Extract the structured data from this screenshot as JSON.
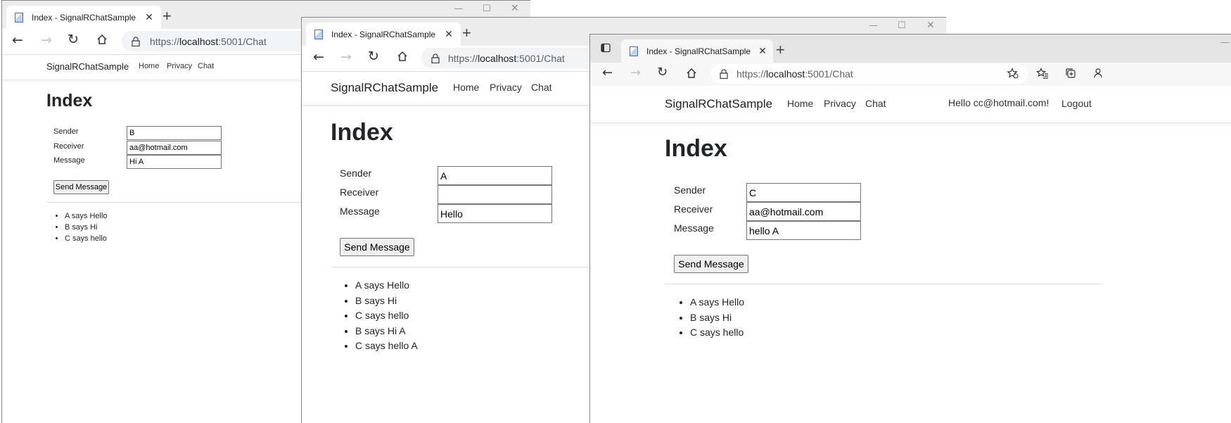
{
  "windows": [
    {
      "tab_title": "Index - SignalRChatSample",
      "url_prefix": "https://",
      "url_host": "localhost",
      "url_rest": ":5001/Chat",
      "brand": "SignalRChatSample",
      "nav": [
        "Home",
        "Privacy",
        "Chat"
      ],
      "heading": "Index",
      "form": {
        "sender_label": "Sender",
        "sender_value": "B",
        "receiver_label": "Receiver",
        "receiver_value": "aa@hotmail.com",
        "message_label": "Message",
        "message_value": "Hi A",
        "send_label": "Send Message"
      },
      "messages": [
        "A says Hello",
        "B says Hi",
        "C says hello"
      ]
    },
    {
      "tab_title": "Index - SignalRChatSample",
      "url_prefix": "https://",
      "url_host": "localhost",
      "url_rest": ":5001/Chat",
      "brand": "SignalRChatSample",
      "nav": [
        "Home",
        "Privacy",
        "Chat"
      ],
      "heading": "Index",
      "form": {
        "sender_label": "Sender",
        "sender_value": "A",
        "receiver_label": "Receiver",
        "receiver_value": "",
        "message_label": "Message",
        "message_value": "Hello",
        "send_label": "Send Message"
      },
      "messages": [
        "A says Hello",
        "B says Hi",
        "C says hello",
        "B says Hi A",
        "C says hello A"
      ]
    },
    {
      "tab_title": "Index - SignalRChatSample",
      "url_prefix": "https://",
      "url_host": "localhost",
      "url_rest": ":5001/Chat",
      "brand": "SignalRChatSample",
      "nav": [
        "Home",
        "Privacy",
        "Chat"
      ],
      "user_greeting": "Hello cc@hotmail.com!",
      "logout": "Logout",
      "heading": "Index",
      "form": {
        "sender_label": "Sender",
        "sender_value": "C",
        "receiver_label": "Receiver",
        "receiver_value": "aa@hotmail.com",
        "message_label": "Message",
        "message_value": "hello A",
        "send_label": "Send Message"
      },
      "messages": [
        "A says Hello",
        "B says Hi",
        "C says hello"
      ]
    }
  ],
  "icons": {
    "minimize": "minimize-icon",
    "maximize": "maximize-icon",
    "close": "close-icon",
    "back": "back-arrow-icon",
    "forward": "forward-arrow-icon",
    "reload": "reload-icon",
    "home": "home-icon",
    "lock": "lock-icon",
    "tab_actions": "tab-actions-icon",
    "favorite_add": "favorite-add-icon",
    "favorites": "favorites-icon",
    "collections": "collections-icon",
    "profile": "profile-icon"
  }
}
